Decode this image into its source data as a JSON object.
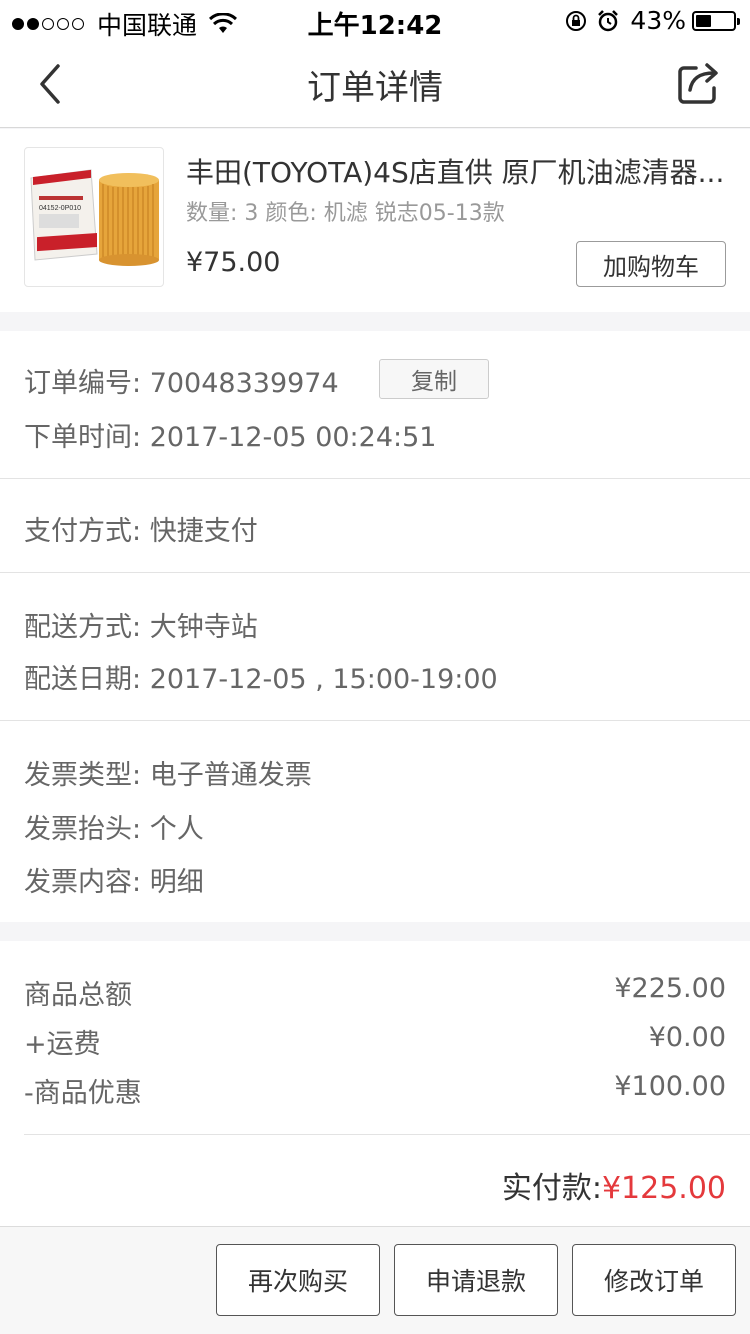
{
  "status_bar": {
    "carrier": "中国联通",
    "time": "上午12:42",
    "battery": "43%",
    "battery_level": 0.43
  },
  "nav": {
    "title": "订单详情"
  },
  "product": {
    "name": "丰田(TOYOTA)4S店直供 原厂机油滤清器...",
    "spec": "数量: 3 颜色: 机滤 锐志05-13款",
    "price": "¥75.00",
    "cart_button": "加购物车",
    "thumb_part_no": "04152-0P010"
  },
  "order": {
    "number_label": "订单编号:",
    "number": "70048339974",
    "copy_button": "复制",
    "time_label": "下单时间:",
    "time": "2017-12-05 00:24:51"
  },
  "payment": {
    "label": "支付方式:",
    "value": "快捷支付"
  },
  "delivery": {
    "method_label": "配送方式:",
    "method": "大钟寺站",
    "date_label": "配送日期:",
    "date": "2017-12-05 , 15:00-19:00"
  },
  "invoice": {
    "type_label": "发票类型:",
    "type": "电子普通发票",
    "title_label": "发票抬头:",
    "title": "个人",
    "content_label": "发票内容:",
    "content": "明细"
  },
  "amounts": {
    "subtotal_label": "商品总额",
    "subtotal": "¥225.00",
    "shipping_label": "+运费",
    "shipping": "¥0.00",
    "discount_label": "-商品优惠",
    "discount": "¥100.00",
    "paid_label": "实付款:",
    "paid": "¥125.00"
  },
  "actions": {
    "buy_again": "再次购买",
    "refund": "申请退款",
    "modify": "修改订单"
  },
  "colors": {
    "accent_red": "#e4393c",
    "text_dark": "#333333",
    "text_gray": "#666666",
    "background": "#f5f5f7"
  }
}
